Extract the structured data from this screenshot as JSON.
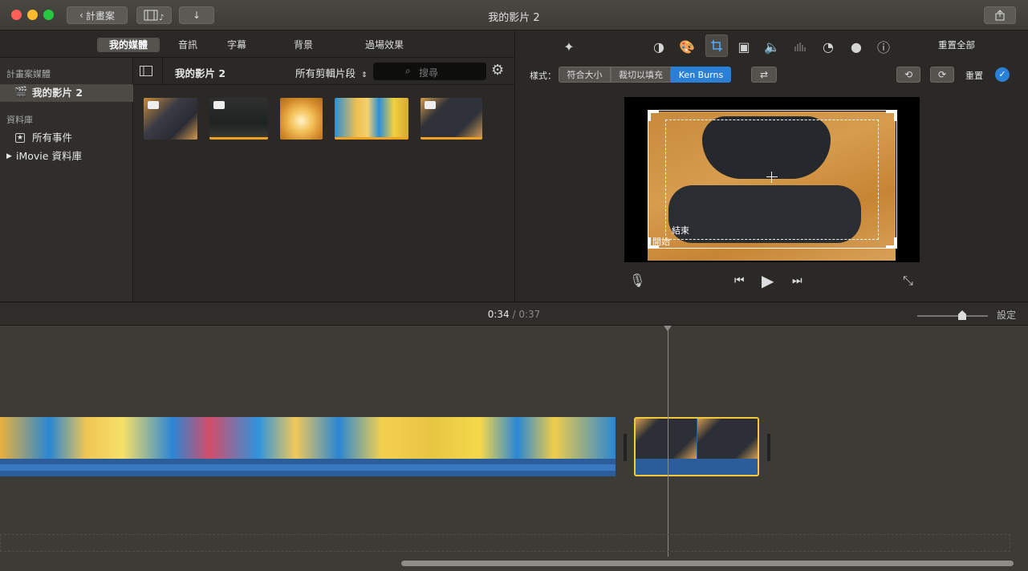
{
  "window": {
    "title": "我的影片 2",
    "back_label": "計畫案"
  },
  "browser_tabs": [
    {
      "label": "我的媒體",
      "active": true
    },
    {
      "label": "音訊",
      "active": false
    },
    {
      "label": "字幕",
      "active": false
    },
    {
      "label": "背景",
      "active": false
    },
    {
      "label": "過場效果",
      "active": false
    }
  ],
  "sidebar": {
    "project_media_header": "計畫案媒體",
    "project_item": "我的影片 2",
    "library_header": "資料庫",
    "all_events": "所有事件",
    "library_item": "iMovie 資料庫"
  },
  "media_toolbar": {
    "title": "我的影片 2",
    "filter": "所有剪輯片段",
    "search_placeholder": "搜尋"
  },
  "viewer": {
    "reset_all": "重置全部",
    "style_label": "樣式：",
    "style_options": [
      "符合大小",
      "裁切以填充",
      "Ken Burns"
    ],
    "style_selected": "Ken Burns",
    "reset": "重置",
    "end_label": "結束",
    "start_label": "開始"
  },
  "timeline": {
    "current_time": "0:34",
    "total_time": "0:37",
    "separator": "/",
    "settings_label": "設定"
  },
  "colors": {
    "accent_blue": "#2a7fd6",
    "clip_selected": "#f3c83b",
    "audio_blue": "#2a5d9a"
  }
}
